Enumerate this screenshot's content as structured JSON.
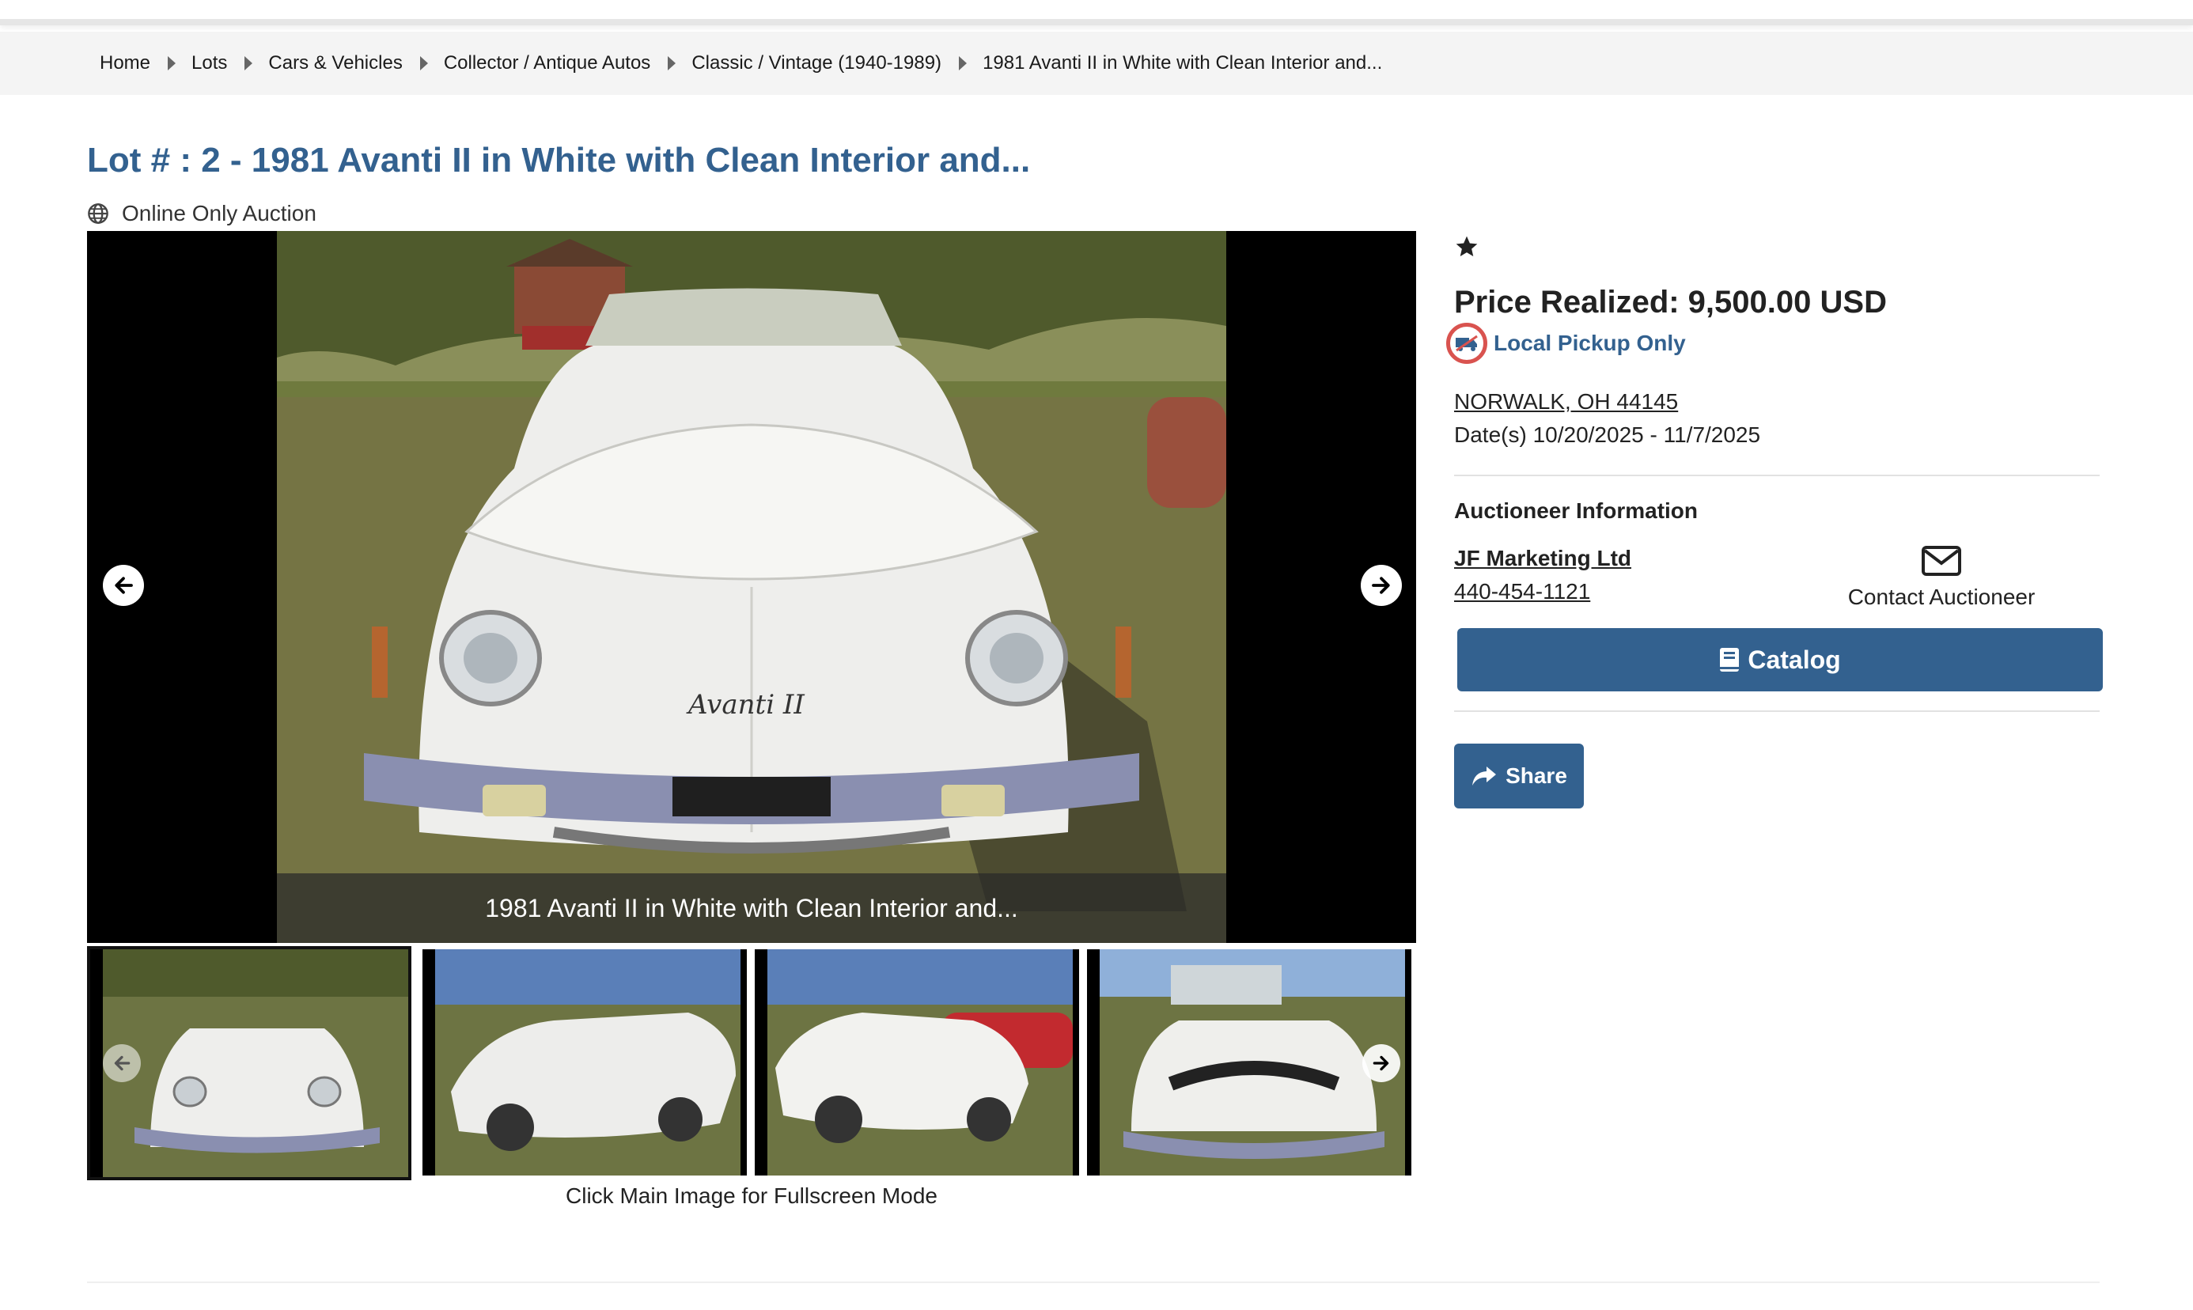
{
  "breadcrumb": [
    {
      "label": "Home"
    },
    {
      "label": "Lots"
    },
    {
      "label": "Cars & Vehicles"
    },
    {
      "label": "Collector / Antique Autos"
    },
    {
      "label": "Classic / Vintage (1940-1989)"
    },
    {
      "label": "1981 Avanti II in White with Clean Interior and..."
    }
  ],
  "lot": {
    "title": "Lot # : 2 - 1981 Avanti II in White with Clean Interior and...",
    "auction_type": "Online Only Auction"
  },
  "gallery": {
    "caption": "1981 Avanti II in White with Clean Interior and...",
    "hint": "Click Main Image for Fullscreen Mode",
    "thumbnail_count": 4,
    "active_thumbnail": 1
  },
  "sidebar": {
    "price": "Price Realized: 9,500.00 USD",
    "pickup": "Local Pickup Only",
    "location": "NORWALK, OH 44145",
    "dates": "Date(s) 10/20/2025 - 11/7/2025",
    "auctioneer_heading": "Auctioneer Information",
    "auctioneer_name": "JF Marketing Ltd",
    "auctioneer_phone": "440-454-1121",
    "contact_label": "Contact Auctioneer",
    "catalog_label": "Catalog",
    "share_label": "Share"
  },
  "colors": {
    "brand": "#33618f",
    "pickup_badge": "#d9534f"
  },
  "icons": [
    "chevron-right-icon",
    "globe-icon",
    "arrow-left-icon",
    "arrow-right-icon",
    "star-icon",
    "no-shipping-icon",
    "envelope-icon",
    "book-icon",
    "share-icon"
  ]
}
